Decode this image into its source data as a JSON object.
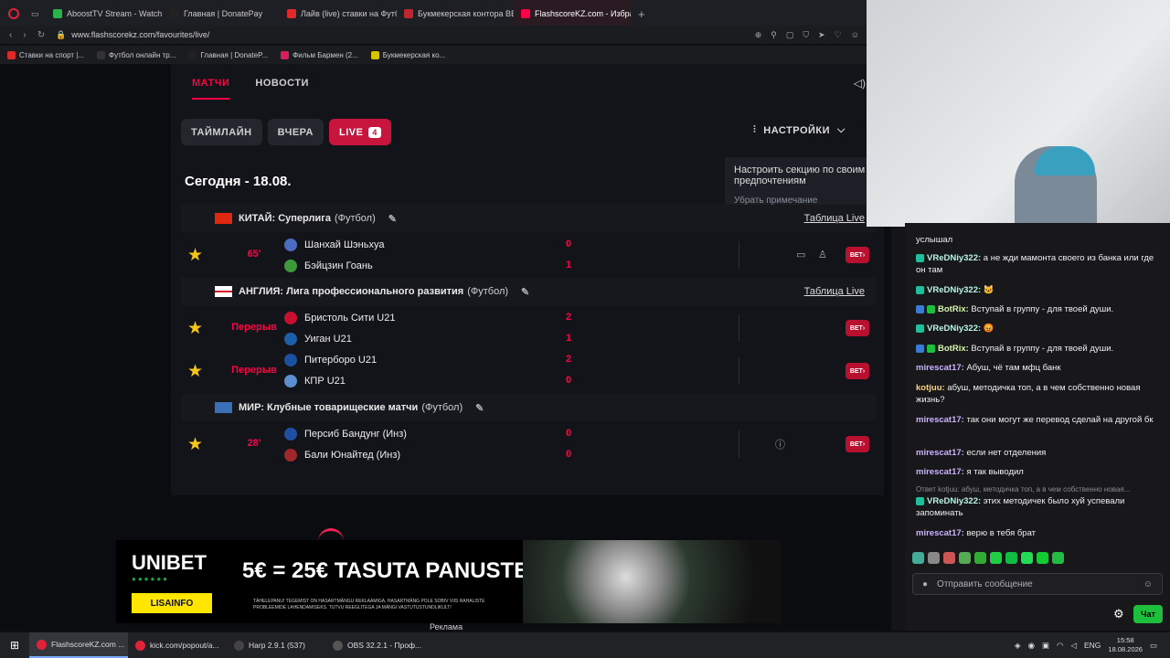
{
  "browser": {
    "tabs": [
      {
        "label": "AboostTV Stream - Watch",
        "color": "#2bb34a",
        "active": false
      },
      {
        "label": "Главная | DonatePay",
        "color": "#222222",
        "active": false
      },
      {
        "label": "Лайв (live) ставки на Футб",
        "color": "#e02a2a",
        "active": false
      },
      {
        "label": "Букмекерская контора BE",
        "color": "#c0262d",
        "active": false
      },
      {
        "label": "FlashscoreKZ.com - Избра",
        "color": "#ff0046",
        "active": true
      }
    ],
    "new_tab": "+",
    "url": "www.flashscorekz.com/favourites/live/",
    "bookmarks": [
      {
        "label": "Ставки на спорт |...",
        "color": "#e02a2a"
      },
      {
        "label": "Футбол онлайн тр...",
        "color": "#333333"
      },
      {
        "label": "Главная | DonateP...",
        "color": "#222222"
      },
      {
        "label": "Фильм Бармен (2...",
        "color": "#d81e5b"
      },
      {
        "label": "Букмекерская ко...",
        "color": "#d6c400"
      }
    ]
  },
  "flashscore": {
    "nav_tabs": [
      "МАТЧИ",
      "НОВОСТИ"
    ],
    "filters": {
      "timeline": "ТАЙМЛАЙН",
      "yesterday": "ВЧЕРА",
      "live": "LIVE",
      "live_count": "4"
    },
    "settings_label": "НАСТРОЙКИ",
    "tooltip": {
      "text": "Настроить секцию по своим предпочтениям",
      "hide": "Убрать примечание"
    },
    "date_heading": "Сегодня - 18.08.",
    "table_link": "Таблица Live",
    "bet_label": "BET",
    "leagues": [
      {
        "country": "КИТАЙ: Суперлига",
        "sport": "(Футбол)"
      },
      {
        "country": "АНГЛИЯ: Лига профессионального развития",
        "sport": "(Футбол)"
      },
      {
        "country": "МИР: Клубные товарищеские матчи",
        "sport": "(Футбол)"
      }
    ],
    "matches": [
      {
        "time": "65'",
        "home": "Шанхай Шэньхуа",
        "away": "Бэйцзин Гоань",
        "home_score": "0",
        "away_score": "1"
      },
      {
        "time": "Перерыв",
        "home": "Бристоль Сити U21",
        "away": "Уиган U21",
        "home_score": "2",
        "away_score": "1"
      },
      {
        "time": "Перерыв",
        "home": "Питерборо U21",
        "away": "КПР U21",
        "home_score": "2",
        "away_score": "0"
      },
      {
        "time": "28'",
        "home": "Персиб Бандунг (Инз)",
        "away": "Бали Юнайтед (Инз)",
        "home_score": "0",
        "away_score": "0"
      }
    ]
  },
  "ad": {
    "brand": "UNIBET",
    "promo": "5€ = 25€ TASUTA PANUSTES",
    "button": "LISAINFO",
    "fine_print": "TÄHELEPANU! TEGEMIST ON HASARTMÄNGU REKLAAMIGA. HASARTMÄNG POLE SOBIV VIIS RAHALISTE PROBLEEMIDE LAHENDAMISEKS. TUTVU REEGLITEGA JA MÄNGI VASTUTUSTUNDLIKULT!",
    "label": "Реклама"
  },
  "chat": {
    "messages": [
      {
        "user": "",
        "text": "услышал"
      },
      {
        "user": "VReDNiy322:",
        "text": "а не жди мамонта своего из банка или где он там"
      },
      {
        "user": "VReDNiy322:",
        "text": ""
      },
      {
        "user": "BotRix:",
        "text": "Вступай в группу - для твоей души."
      },
      {
        "user": "VReDNiy322:",
        "text": ""
      },
      {
        "user": "BotRix:",
        "text": "Вступай в группу - для твоей души."
      },
      {
        "user": "mirescat17:",
        "text": "Абуш, чё там мфц банк"
      },
      {
        "user": "kotjuu:",
        "text": "абуш, методичка топ, а в чем собственно новая жизнь?"
      },
      {
        "user": "mirescat17:",
        "text": "так они могут же перевод сделай на другой бк"
      },
      {
        "user": "mirescat17:",
        "text": "если нет отделения"
      },
      {
        "user": "mirescat17:",
        "text": "я так выводил"
      },
      {
        "user": "VReDNiy322:",
        "text": "этих методичек было хуй успевали запоминать"
      },
      {
        "user": "mirescat17:",
        "text": "верю в тебя брат"
      }
    ],
    "reply_hint": "Ответ kotjuu: абуш, методичка топ, а в чем собственно новая...",
    "input_placeholder": "Отправить сообщение",
    "send_label": "Чат"
  },
  "taskbar": {
    "items": [
      {
        "label": "FlashscoreKZ.com ...",
        "color": "#e0233a"
      },
      {
        "label": "kick.com/popout/a...",
        "color": "#e0233a"
      },
      {
        "label": "Harp 2.9.1 (537)",
        "color": "#444444"
      },
      {
        "label": "OBS 32.2.1 - Проф...",
        "color": "#555555"
      }
    ],
    "lang": "ENG",
    "time": "15:58",
    "date": "18.08.2026"
  }
}
